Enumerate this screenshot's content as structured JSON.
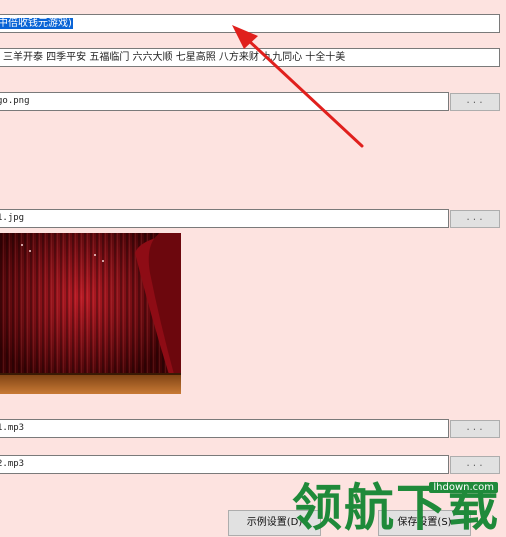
{
  "title_field": {
    "value": "中倍收钱元游戏)"
  },
  "blessings_field": {
    "value": "三羊开泰  四季平安  五福临门  六六大顺  七星高照  八方来财  九九同心  十全十美"
  },
  "logo_field": {
    "value": "go.png"
  },
  "background_field": {
    "value": "1.jpg"
  },
  "music_field_1": {
    "value": "1.mp3"
  },
  "music_field_2": {
    "value": "2.mp3"
  },
  "browse_label": "...",
  "buttons": {
    "example": "示例设置(D)",
    "save": "保存设置(S)"
  },
  "watermark": {
    "brand": "领航下载",
    "url": "lhdown.com"
  }
}
